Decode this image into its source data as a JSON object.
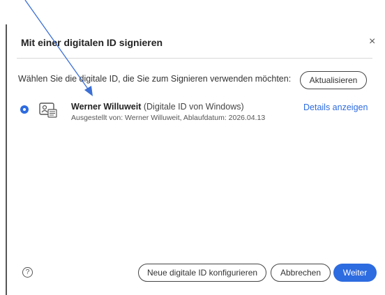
{
  "dialog": {
    "title": "Mit einer digitalen ID signieren",
    "close_symbol": "×",
    "instruction": "Wählen Sie die digitale ID, die Sie zum Signieren verwenden möchten:",
    "refresh_button": "Aktualisieren",
    "identity": {
      "name": "Werner Willuweit",
      "type": "(Digitale ID von Windows)",
      "details": "Ausgestellt von: Werner Willuweit, Ablaufdatum: 2026.04.13",
      "selected": true,
      "icon": "id-card-icon"
    },
    "details_link": "Details anzeigen",
    "help_symbol": "?",
    "buttons": {
      "configure": "Neue digitale ID konfigurieren",
      "cancel": "Abbrechen",
      "next": "Weiter"
    }
  },
  "colors": {
    "accent": "#2d6be0",
    "annotation_arrow": "#3b6fd6"
  },
  "annotation": {
    "icon": "arrow-annotation-icon"
  }
}
